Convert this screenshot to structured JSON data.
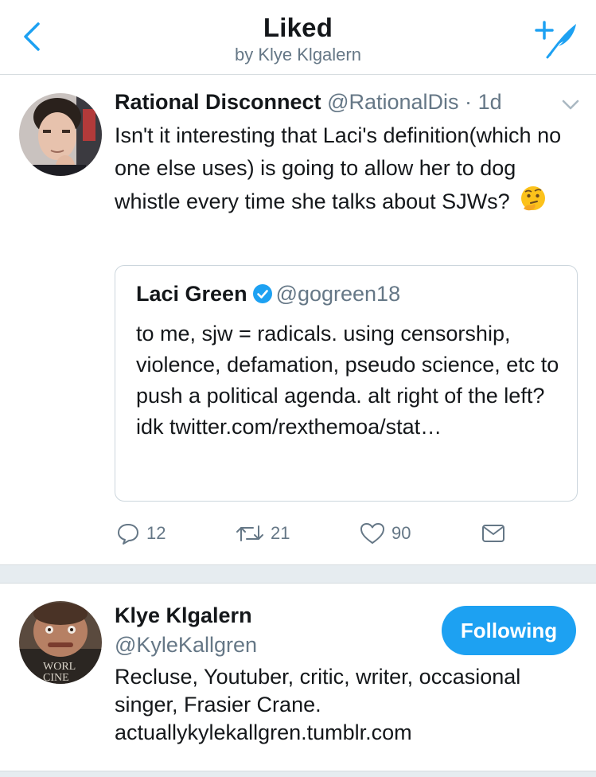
{
  "header": {
    "title": "Liked",
    "subtitle": "by Klye Klgalern",
    "accent_color": "#1da1f2",
    "back_icon": "chevron-left-icon",
    "compose_icon": "compose-tweet-icon"
  },
  "tweet": {
    "author_name": "Rational Disconnect",
    "author_handle": "@RationalDis",
    "separator": "·",
    "time": "1d",
    "text": "Isn't it interesting that Laci's definition(which no one else uses) is going to allow her to dog whistle every time she talks about SJWs?",
    "emoji": "thinking-face-emoji",
    "quoted": {
      "author_name": "Laci Green",
      "verified": true,
      "author_handle": "@gogreen18",
      "text": "to me, sjw = radicals. using censorship, violence, defamation, pseudo science, etc to push a political agenda. alt right of the left? idk twitter.com/rexthemoa/stat…"
    },
    "actions": {
      "reply_count": "12",
      "retweet_count": "21",
      "like_count": "90"
    }
  },
  "user_card": {
    "name": "Klye Klgalern",
    "handle": "@KyleKallgren",
    "follow_label": "Following",
    "bio": "Recluse, Youtuber, critic, writer, occasional singer, Frasier Crane. actuallykylekallgren.tumblr.com"
  }
}
